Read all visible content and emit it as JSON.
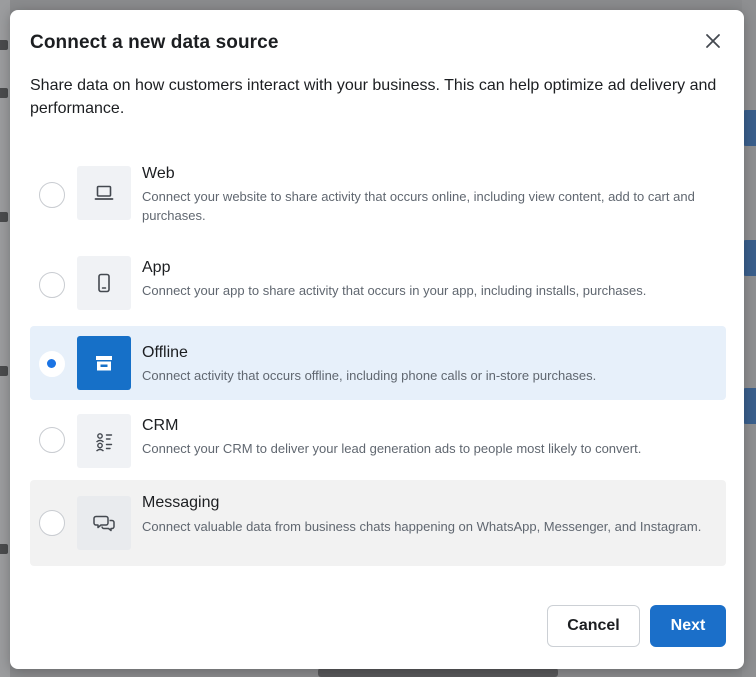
{
  "modal": {
    "title": "Connect a new data source",
    "description": "Share data on how customers interact with your business. This can help optimize ad delivery and performance.",
    "close_icon": "close-icon"
  },
  "options": [
    {
      "title": "Web",
      "description": "Connect your website to share activity that occurs online, including view content, add to cart and purchases.",
      "icon": "laptop-icon",
      "selected": false,
      "state": "default"
    },
    {
      "title": "App",
      "description": "Connect your app to share activity that occurs in your app, including installs, purchases.",
      "icon": "phone-icon",
      "selected": false,
      "state": "default"
    },
    {
      "title": "Offline",
      "description": "Connect activity that occurs offline, including phone calls or in-store purchases.",
      "icon": "store-icon",
      "selected": true,
      "state": "selected"
    },
    {
      "title": "CRM",
      "description": "Connect your CRM to deliver your lead generation ads to people most likely to convert.",
      "icon": "crm-people-icon",
      "selected": false,
      "state": "default"
    },
    {
      "title": "Messaging",
      "description": "Connect valuable data from business chats happening on WhatsApp, Messenger, and Instagram.",
      "icon": "chat-bubbles-icon",
      "selected": false,
      "state": "disabled"
    }
  ],
  "footer": {
    "cancel_label": "Cancel",
    "next_label": "Next"
  },
  "colors": {
    "accent": "#1b6fc9",
    "selected_row_bg": "#e7f0fa",
    "disabled_row_bg": "#f2f2f2"
  }
}
